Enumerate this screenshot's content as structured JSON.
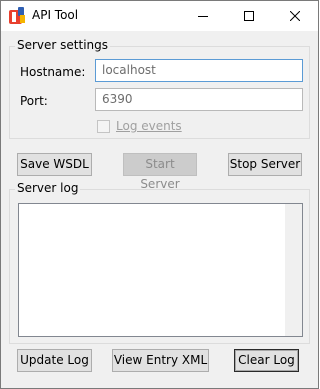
{
  "window": {
    "title": "API Tool"
  },
  "server_settings": {
    "title": "Server settings",
    "hostname_label": "Hostname:",
    "hostname_value": "localhost",
    "port_label": "Port:",
    "port_value": "6390",
    "log_events_label": "Log events",
    "log_events_checked": false
  },
  "buttons": {
    "save_wsdl_label": "Save WSDL",
    "start_server_label": "Start Server",
    "stop_server_label": "Stop Server",
    "update_log_label": "Update Log",
    "view_entry_xml_label": "View Entry XML",
    "clear_log_label": "Clear Log"
  },
  "server_log": {
    "title": "Server log",
    "content": ""
  },
  "icons": {
    "app": "app-icon",
    "minimize": "minimize-icon",
    "maximize": "maximize-icon",
    "close": "close-icon"
  },
  "colors": {
    "focus_border": "#5b9bd5",
    "window_bg": "#f0f0f0"
  }
}
